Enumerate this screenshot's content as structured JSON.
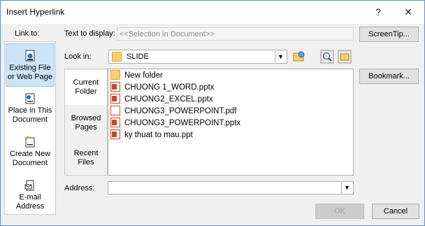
{
  "window": {
    "title": "Insert Hyperlink",
    "help_label": "?",
    "close_label": "✕"
  },
  "link_to": {
    "label": "Link to:",
    "items": [
      {
        "label": "Existing File or Web Page",
        "selected": true
      },
      {
        "label": "Place in This Document"
      },
      {
        "label": "Create New Document"
      },
      {
        "label": "E-mail Address"
      }
    ]
  },
  "text_to_display": {
    "label": "Text to display:",
    "value": "<<Selection in Document>>"
  },
  "screentip_button": "ScreenTip...",
  "look_in": {
    "label": "Look in:",
    "value": "SLIDE"
  },
  "bookmark_button": "Bookmark...",
  "subtabs": [
    {
      "label": "Current Folder",
      "selected": true
    },
    {
      "label": "Browsed Pages"
    },
    {
      "label": "Recent Files"
    }
  ],
  "files": [
    {
      "name": "New folder",
      "icon": "folder-icon"
    },
    {
      "name": "CHUONG 1_WORD.pptx",
      "icon": "pptx-icon"
    },
    {
      "name": "CHUONG2_EXCEL.pptx",
      "icon": "pptx-icon"
    },
    {
      "name": "CHUONG3_POWERPOINT.pdf",
      "icon": "pdf-icon"
    },
    {
      "name": "CHUONG3_POWERPOINT.pptx",
      "icon": "pptx-icon"
    },
    {
      "name": "ky thuat to mau.ppt",
      "icon": "ppt-icon"
    }
  ],
  "address": {
    "label": "Address:",
    "value": ""
  },
  "ok_button": "OK",
  "cancel_button": "Cancel"
}
